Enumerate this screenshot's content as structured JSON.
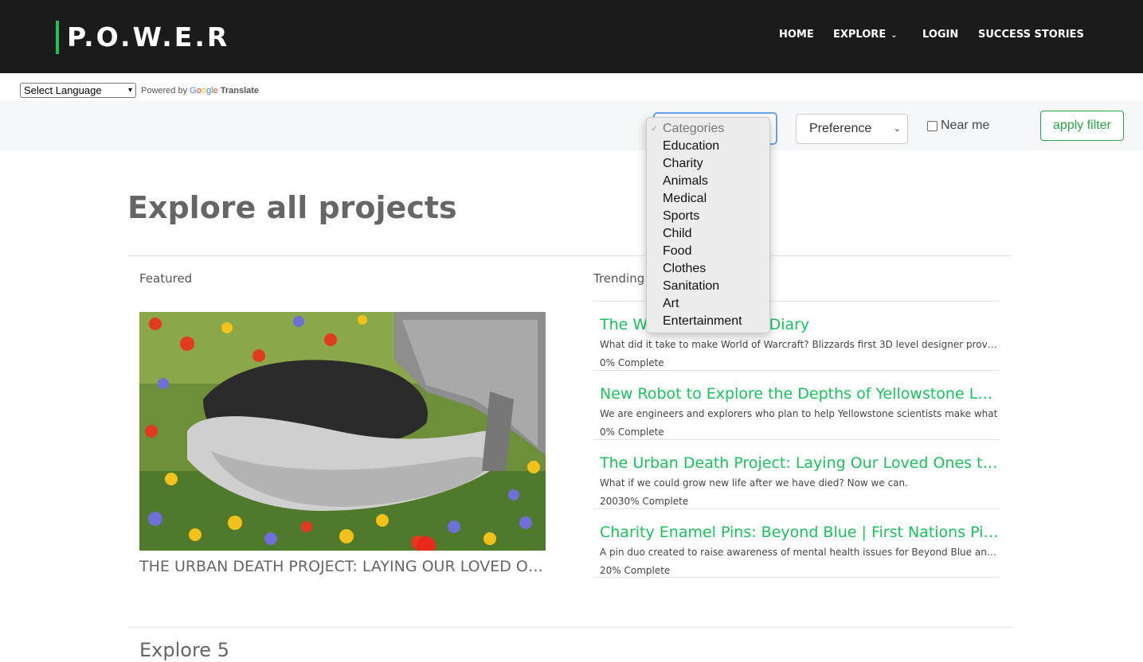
{
  "header": {
    "logo": "P.O.W.E.R",
    "nav": [
      {
        "label": "HOME"
      },
      {
        "label": "EXPLORE"
      },
      {
        "label": "LOGIN"
      },
      {
        "label": "SUCCESS STORIES"
      }
    ]
  },
  "translate": {
    "select_label": "Select Language",
    "powered_by": "Powered by",
    "google": [
      "G",
      "o",
      "o",
      "g",
      "l",
      "e"
    ],
    "translate_label": "Translate"
  },
  "filters": {
    "preference_label": "Preference",
    "near_me_label": "Near me",
    "near_me_checked": false,
    "apply_label": "apply filter",
    "categories_dropdown": {
      "open": true,
      "selected": "Categories",
      "options": [
        "Categories",
        "Education",
        "Charity",
        "Animals",
        "Medical",
        "Sports",
        "Child",
        "Food",
        "Clothes",
        "Sanitation",
        "Art",
        "Entertainment"
      ]
    }
  },
  "main": {
    "title": "Explore all projects",
    "featured_label": "Featured",
    "trending_label": "Trending",
    "featured": {
      "caption": "THE URBAN DEATH PROJECT: LAYING OUR LOVED ONES"
    },
    "trending": [
      {
        "title": "The World of Warcraft Diary",
        "description": "What did it take to make World of Warcraft? Blizzards first 3D level designer provides",
        "progress": "0% Complete"
      },
      {
        "title": "New Robot to Explore the Depths of Yellowstone Lakes",
        "description": "We are engineers and explorers who plan to help Yellowstone scientists make what",
        "progress": "0% Complete"
      },
      {
        "title": "The Urban Death Project: Laying Our Loved Ones to Rest",
        "description": "What if we could grow new life after we have died? Now we can.",
        "progress": "20030% Complete"
      },
      {
        "title": "Charity Enamel Pins: Beyond Blue | First Nations Pins",
        "description": "A pin duo created to raise awareness of mental health issues for Beyond Blue and s",
        "progress": "20% Complete"
      }
    ],
    "next_section_title": "Explore 5"
  },
  "colors": {
    "accent_green": "#19c35a",
    "button_green": "#28a745",
    "header_bg": "#1b1b1b",
    "focus_blue": "#6aa0f0"
  }
}
